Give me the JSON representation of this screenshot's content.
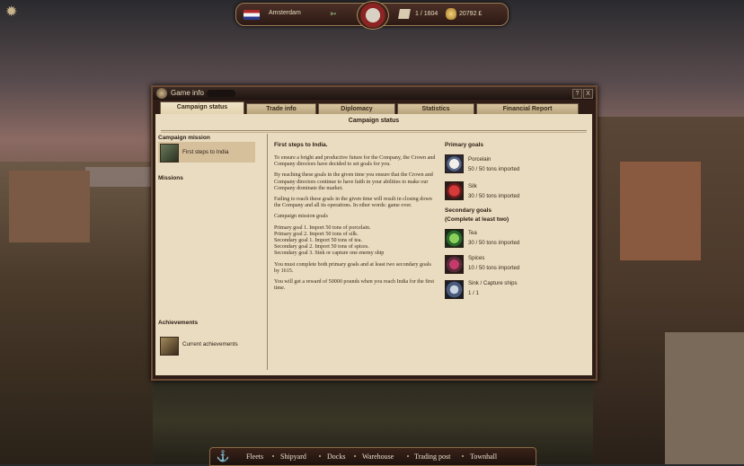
{
  "topbar": {
    "city": "Amsterdam",
    "ships": "1 / 1604",
    "money": "20792 £"
  },
  "window": {
    "title": "Game info",
    "help_label": "?",
    "close_label": "X",
    "tabs": [
      {
        "label": "Campaign status",
        "active": true
      },
      {
        "label": "Trade info",
        "active": false
      },
      {
        "label": "Diplomacy",
        "active": false
      },
      {
        "label": "Statistics",
        "active": false
      },
      {
        "label": "Financial Report",
        "active": false
      }
    ],
    "header": "Campaign status",
    "left": {
      "campaign_mission_title": "Campaign mission",
      "campaign_mission_item": "First steps to India",
      "missions_title": "Missions",
      "achievements_title": "Achievements",
      "achievements_item": "Current achievements"
    },
    "mission": {
      "title": "First steps to India.",
      "paragraphs": [
        "To ensure a bright and productive future for the Company, the Crown and Company directors have decided to set goals for you.",
        "By reaching these goals in the given time you ensure that the Crown and Company directors continue to have faith in your abilities to make our Company dominate the market.",
        "Failing to reach these goals in the given time will result in closing down the Company and all its operations. In other words: game over.",
        "Campaign mission goals"
      ],
      "goals": [
        "Primary goal 1. Import 50 tons of porcelain.",
        "Primary goal 2. Import 50 tons of silk.",
        "Secondary goal 1. Import 50 tons of tea.",
        "Secondary goal 2. Import 50 tons of spices.",
        "Secondary goal 3. Sink or capture one enemy ship"
      ],
      "closing": [
        "You must complete both primary goals and at least two secondary goals by 1615.",
        "You will get a reward of 50000 pounds when you reach India for the first time."
      ]
    },
    "right": {
      "primary_title": "Primary goals",
      "secondary_title": "Secondary goals",
      "secondary_note": "(Complete at least two)",
      "primary_goals": [
        {
          "name": "Porcelain",
          "progress": "50 / 50 tons imported",
          "icon": "porcelain-icon"
        },
        {
          "name": "Silk",
          "progress": "30 / 50 tons imported",
          "icon": "silk-icon"
        }
      ],
      "secondary_goals": [
        {
          "name": "Tea",
          "progress": "30 / 50 tons imported",
          "icon": "tea-icon"
        },
        {
          "name": "Spices",
          "progress": "10 / 50 tons imported",
          "icon": "spices-icon"
        },
        {
          "name": "Sink / Capture ships",
          "progress": "1 / 1",
          "icon": "ship-icon"
        }
      ]
    }
  },
  "bottombar": {
    "items": [
      "Fleets",
      "Shipyard",
      "Docks",
      "Warehouse",
      "Trading post",
      "Townhall"
    ]
  }
}
